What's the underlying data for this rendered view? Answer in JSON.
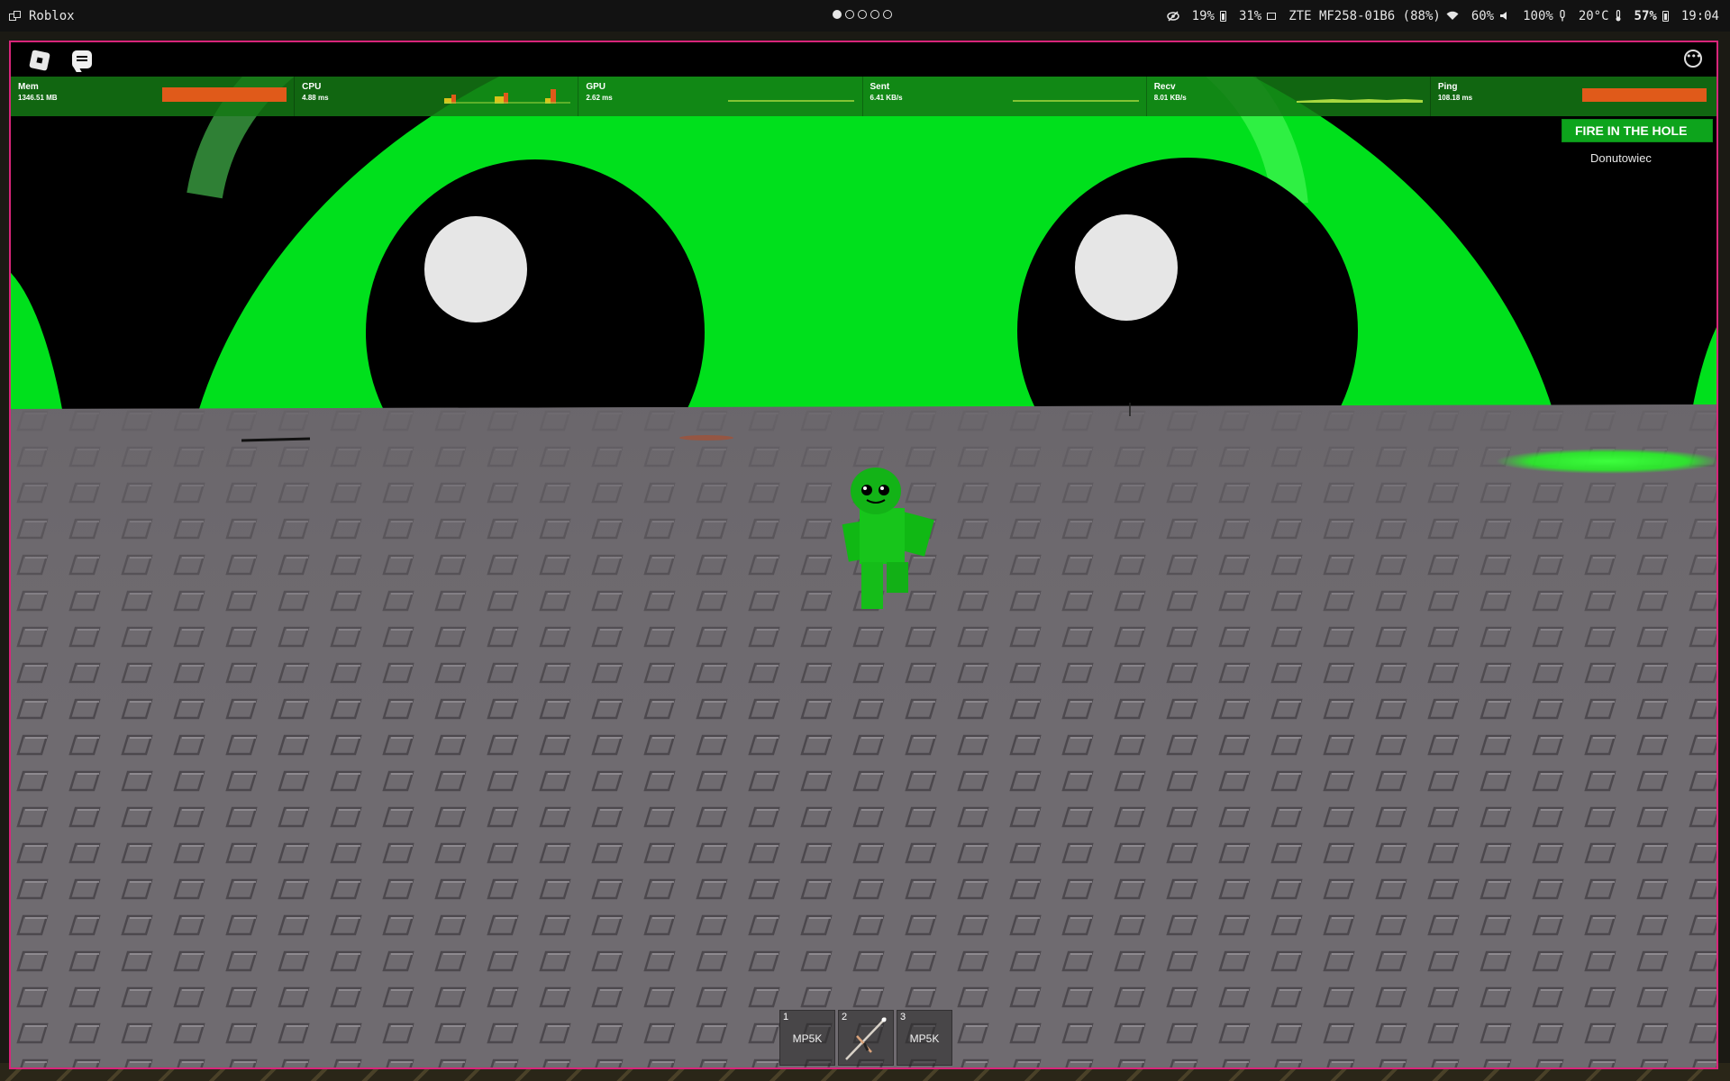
{
  "topbar": {
    "app_title": "Roblox",
    "workspaces": [
      true,
      false,
      false,
      false,
      false
    ],
    "stats": [
      {
        "id": "privacy",
        "text": "19%"
      },
      {
        "id": "cpu-load",
        "text": "31%"
      }
    ],
    "network_name": "ZTE MF258-01B6 (88%)",
    "brightness": "60%",
    "volume": "100%",
    "temperature": "20°C",
    "battery": "57%",
    "clock": "19:04"
  },
  "performance": [
    {
      "name": "Mem",
      "value": "1346.51 MB"
    },
    {
      "name": "CPU",
      "value": "4.88 ms"
    },
    {
      "name": "GPU",
      "value": "2.62 ms"
    },
    {
      "name": "Sent",
      "value": "6.41 KB/s"
    },
    {
      "name": "Recv",
      "value": "8.01 KB/s"
    },
    {
      "name": "Ping",
      "value": "108.18 ms"
    }
  ],
  "leaderboard": {
    "title": "FIRE IN THE HOLE",
    "players": [
      "Donutowiec"
    ]
  },
  "hotbar": [
    {
      "number": "1",
      "label": "MP5K"
    },
    {
      "number": "2",
      "label": ""
    },
    {
      "number": "3",
      "label": "MP5K"
    }
  ],
  "colors": {
    "window_border": "#d8257a",
    "stats_background": "#147814",
    "leaderboard_header": "#0da41c",
    "giant_face": "#00e01c",
    "ground": "#6f6b70"
  }
}
